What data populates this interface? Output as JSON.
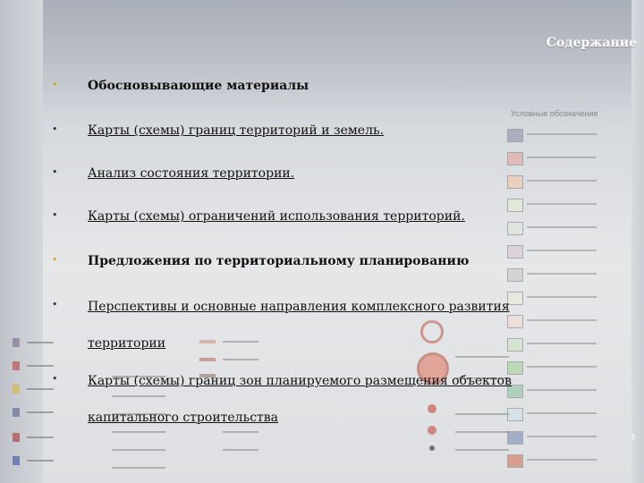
{
  "slide": {
    "title": "Содержание",
    "page_number": "3"
  },
  "items": [
    {
      "bullet": "•",
      "text": "Обосновывающие материалы"
    },
    {
      "bullet": "•",
      "text": "Карты (схемы) границ территорий и земель."
    },
    {
      "bullet": "•",
      "text": "Анализ состояния территории."
    },
    {
      "bullet": "•",
      "text": "Карты (схемы) ограничений использования территорий."
    },
    {
      "bullet": "•",
      "text": "Предложения по территориальному планированию"
    },
    {
      "bullet": "•",
      "text": "Перспективы и основные направления комплексного развития территории"
    },
    {
      "bullet": "•",
      "text": "Карты (схемы) границ зон планируемого размещения объектов капитального строительства"
    }
  ],
  "legend": {
    "title": "Условные обозначения",
    "swatch_colors": [
      "#8f96ad",
      "#e3a89e",
      "#f2c9a9",
      "#e4eed6",
      "#dfe6e0",
      "#d9c6d3",
      "#c8c8c8",
      "#e8e8d8",
      "#f3d9d5",
      "#cfe5c7",
      "#a8d29a",
      "#8fc4a1",
      "#cfe3ec",
      "#7d8fb5",
      "#d2785c"
    ]
  },
  "colors": {
    "title_text": "#ffffff",
    "bullet_gold": "#d9a520",
    "bullet_dark": "#2e3440"
  }
}
